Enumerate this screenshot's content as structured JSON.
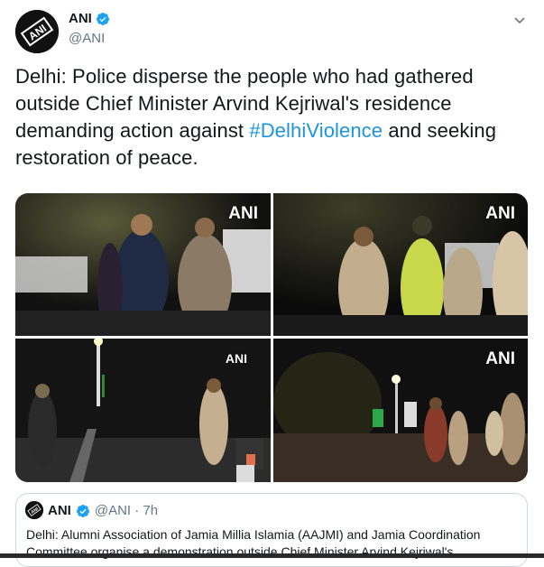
{
  "author": {
    "display_name": "ANI",
    "handle": "@ANI",
    "avatar_text": "ANI"
  },
  "tweet": {
    "text_before": "Delhi: Police disperse the people who had gathered outside Chief Minister Arvind Kejriwal's residence demanding action against ",
    "hashtag": "#DelhiViolence",
    "text_after": " and seeking restoration of peace."
  },
  "media": {
    "watermark": "ANI",
    "photos": [
      {
        "watermark": "ANI"
      },
      {
        "watermark": "ANI"
      },
      {
        "watermark": "ANI"
      },
      {
        "watermark": "ANI"
      }
    ]
  },
  "quoted_tweet": {
    "display_name": "ANI",
    "handle_time": "@ANI · 7h",
    "text": "Delhi: Alumni Association of Jamia Millia Islamia (AAJMI) and Jamia Coordination Committee organise a demonstration outside Chief Minister Arvind Kejriwal's"
  },
  "colors": {
    "link": "#1b95e0",
    "verified": "#1da1f2",
    "secondary_text": "#657786"
  },
  "icons": [
    "ani-logo-avatar",
    "verified-icon",
    "chevron-down-icon"
  ]
}
